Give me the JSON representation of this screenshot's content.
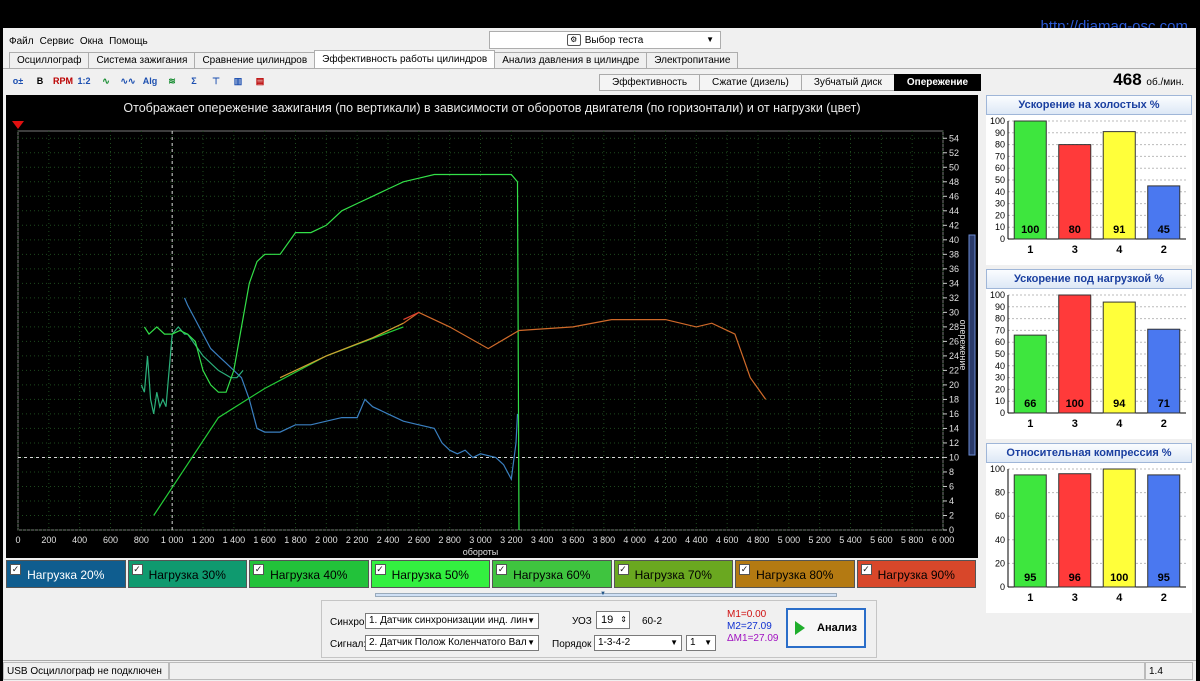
{
  "url": "http://diamag-osc.com",
  "menu": [
    "Файл",
    "Сервис",
    "Окна",
    "Помощь"
  ],
  "test_select": "Выбор теста",
  "tabs": [
    {
      "label": "Осциллограф",
      "active": false
    },
    {
      "label": "Система зажигания",
      "active": false
    },
    {
      "label": "Сравнение цилиндров",
      "active": false
    },
    {
      "label": "Эффективность работы цилиндров",
      "active": true
    },
    {
      "label": "Анализ давления в цилиндре",
      "active": false
    },
    {
      "label": "Электропитание",
      "active": false
    }
  ],
  "subtabs": [
    {
      "label": "Эффективность",
      "active": false
    },
    {
      "label": "Сжатие (дизель)",
      "active": false
    },
    {
      "label": "Зубчатый диск",
      "active": false
    },
    {
      "label": "Опережение",
      "active": true
    }
  ],
  "rpm": {
    "value": "468",
    "unit": "об./мин."
  },
  "main_chart": {
    "title": "Отображает опережение зажигания (по вертикали) в зависимости от оборотов двигателя (по горизонтали) и от нагрузки (цвет)",
    "xlabel": "обороты",
    "ylabel": "опережение"
  },
  "chart_data": [
    {
      "type": "line",
      "title": "Отображает опережение зажигания (по вертикали) в зависимости от оборотов двигателя (по горизонтали) и от нагрузки (цвет)",
      "xlabel": "обороты",
      "ylabel": "опережение",
      "xlim": [
        0,
        6000
      ],
      "ylim": [
        0,
        55
      ],
      "xticks": [
        0,
        200,
        400,
        600,
        800,
        1000,
        1200,
        1400,
        1600,
        1800,
        2000,
        2200,
        2400,
        2600,
        2800,
        3000,
        3200,
        3400,
        3600,
        3800,
        4000,
        4200,
        4400,
        4600,
        4800,
        5000,
        5200,
        5400,
        5600,
        5800,
        6000
      ],
      "xtick_labels": [
        "0",
        "200",
        "400",
        "600",
        "800",
        "1 000",
        "1 200",
        "1 400",
        "1 600",
        "1 800",
        "2 000",
        "2 200",
        "2 400",
        "2 600",
        "2 800",
        "3 000",
        "3 200",
        "3 400",
        "3 600",
        "3 800",
        "4 000",
        "4 200",
        "4 400",
        "4 600",
        "4 800",
        "5 000",
        "5 200",
        "5 400",
        "5 600",
        "5 800",
        "6 000"
      ],
      "yticks": [
        0,
        2,
        4,
        6,
        8,
        10,
        12,
        14,
        16,
        18,
        20,
        22,
        24,
        26,
        28,
        30,
        32,
        34,
        36,
        38,
        40,
        42,
        44,
        46,
        48,
        50,
        52,
        54
      ],
      "grid": true,
      "cursor": {
        "x": 1000,
        "y": 10
      },
      "series": [
        {
          "name": "Нагрузка 20%",
          "color": "#3a7fc0",
          "x": [
            1080,
            1100,
            1150,
            1200,
            1250,
            1300,
            1350,
            1400,
            1450,
            1500,
            1550,
            1600,
            1700,
            1800,
            1900,
            2000,
            2100,
            2200,
            2250,
            2300,
            2400,
            2500,
            2600,
            2700,
            2750,
            2800,
            2850,
            2900,
            2950,
            3000,
            3100,
            3150,
            3200,
            3230,
            3240
          ],
          "y": [
            32,
            31,
            29,
            27,
            25,
            24,
            23,
            22,
            21,
            18,
            14,
            13.5,
            13.5,
            14.5,
            14.5,
            15,
            15.5,
            15.5,
            18,
            17,
            16,
            15,
            14.5,
            14,
            12,
            11,
            10.5,
            11,
            10,
            10.5,
            10,
            9,
            7,
            12,
            16
          ]
        },
        {
          "name": "Нагрузка 30%",
          "color": "#2bb07a",
          "x": [
            800,
            820,
            840,
            860,
            880,
            900,
            920,
            940,
            960,
            1000,
            1040,
            1080,
            1100,
            1200,
            1300,
            1340,
            1380,
            1420,
            1460
          ],
          "y": [
            20,
            19,
            24,
            18,
            16,
            19,
            17,
            18,
            17,
            27,
            28,
            27,
            27,
            24,
            22,
            21.5,
            21,
            21,
            22
          ]
        },
        {
          "name": "Нагрузка 40%",
          "color": "#24cc37",
          "x": [
            880,
            1300,
            1600,
            2000,
            2500
          ],
          "y": [
            2,
            15.5,
            19.5,
            24,
            28
          ]
        },
        {
          "name": "Нагрузка 50%",
          "color": "#33e048",
          "x": [
            820,
            850,
            900,
            950,
            1000,
            1050,
            1100,
            1150,
            1200,
            1250,
            1300,
            1350,
            1400,
            1450,
            1500,
            1550,
            1600,
            1700,
            1800,
            1900,
            2000,
            2100,
            2200,
            2300,
            2400,
            2500,
            2600,
            2700,
            2800,
            2900,
            3000,
            3100,
            3200,
            3240,
            3250
          ],
          "y": [
            28,
            27,
            28,
            27,
            27,
            27.5,
            27,
            26,
            22,
            20,
            19,
            19,
            22,
            28,
            34,
            37,
            38,
            38,
            41,
            41,
            42,
            44,
            45,
            46,
            47,
            48,
            48.5,
            49,
            49,
            49,
            49,
            49,
            49,
            48,
            0
          ]
        },
        {
          "name": "Нагрузка 70%",
          "color": "#d0a030",
          "x": [
            1700,
            2000,
            2300,
            2500
          ],
          "y": [
            21,
            24,
            26.5,
            28.5
          ]
        },
        {
          "name": "Нагрузка 80%",
          "color": "#d06a2a",
          "x": [
            2500,
            2600,
            2800,
            3050,
            3250,
            3600,
            3850,
            4200,
            4400,
            4500,
            4650,
            4750,
            4850
          ],
          "y": [
            28.5,
            30,
            28,
            25,
            27.5,
            28,
            29,
            29,
            28,
            28.5,
            27,
            21,
            18
          ]
        },
        {
          "name": "Нагрузка 90%",
          "color": "#e04030",
          "x": [
            2500,
            2600
          ],
          "y": [
            29,
            30
          ]
        }
      ]
    },
    {
      "type": "bar",
      "title": "Ускорение на холостых %",
      "categories": [
        "1",
        "3",
        "4",
        "2"
      ],
      "values": [
        100,
        80,
        91,
        45
      ],
      "colors": [
        "#3ee63e",
        "#ff3a3a",
        "#ffff3a",
        "#4a78f0"
      ],
      "ylim": [
        0,
        100
      ],
      "yticks": [
        0,
        10,
        20,
        30,
        40,
        50,
        60,
        70,
        80,
        90,
        100
      ]
    },
    {
      "type": "bar",
      "title": "Ускорение под нагрузкой %",
      "categories": [
        "1",
        "3",
        "4",
        "2"
      ],
      "values": [
        66,
        100,
        94,
        71
      ],
      "colors": [
        "#3ee63e",
        "#ff3a3a",
        "#ffff3a",
        "#4a78f0"
      ],
      "ylim": [
        0,
        100
      ],
      "yticks": [
        0,
        10,
        20,
        30,
        40,
        50,
        60,
        70,
        80,
        90,
        100
      ]
    },
    {
      "type": "bar",
      "title": "Относительная компрессия %",
      "categories": [
        "1",
        "3",
        "4",
        "2"
      ],
      "values": [
        95,
        96,
        100,
        95
      ],
      "colors": [
        "#3ee63e",
        "#ff3a3a",
        "#ffff3a",
        "#4a78f0"
      ],
      "ylim": [
        0,
        100
      ],
      "yticks": [
        0,
        20,
        40,
        60,
        80,
        100
      ]
    }
  ],
  "legend": [
    {
      "label": "Нагрузка 20%",
      "color": "#0f5d8f",
      "text": "white"
    },
    {
      "label": "Нагрузка 30%",
      "color": "#0f9a6f",
      "text": "black"
    },
    {
      "label": "Нагрузка 40%",
      "color": "#22c23a",
      "text": "black"
    },
    {
      "label": "Нагрузка 50%",
      "color": "#33f040",
      "text": "black"
    },
    {
      "label": "Нагрузка 60%",
      "color": "#3fc43f",
      "text": "black"
    },
    {
      "label": "Нагрузка 70%",
      "color": "#6aa820",
      "text": "black"
    },
    {
      "label": "Нагрузка 80%",
      "color": "#b47a12",
      "text": "black"
    },
    {
      "label": "Нагрузка 90%",
      "color": "#d8472a",
      "text": "black"
    }
  ],
  "controls": {
    "sync_label": "Синхро:",
    "sync_value": "1.  Датчик синхронизации инд. лин",
    "signal_label": "Сигнал:",
    "signal_value": "2.  Датчик Полож Коленчатого Вал",
    "uoz_label": "УОЗ",
    "uoz_value": "19",
    "teeth": "60-2",
    "order_label": "Порядок",
    "order_value": "1-3-4-2",
    "order_num": "1",
    "m1": "M1=0.00",
    "m2": "M2=27.09",
    "dm1": "ΔM1=27.09",
    "analyze": "Анализ"
  },
  "status": {
    "left": "USB Осциллограф не подключен",
    "version": "1.4"
  },
  "toolbar_icons": [
    "o±",
    "B",
    "RPM",
    "1:2",
    "∿",
    "∿∿",
    "Alg",
    "≋",
    "Σ",
    "⊤",
    "▥",
    "▤"
  ]
}
